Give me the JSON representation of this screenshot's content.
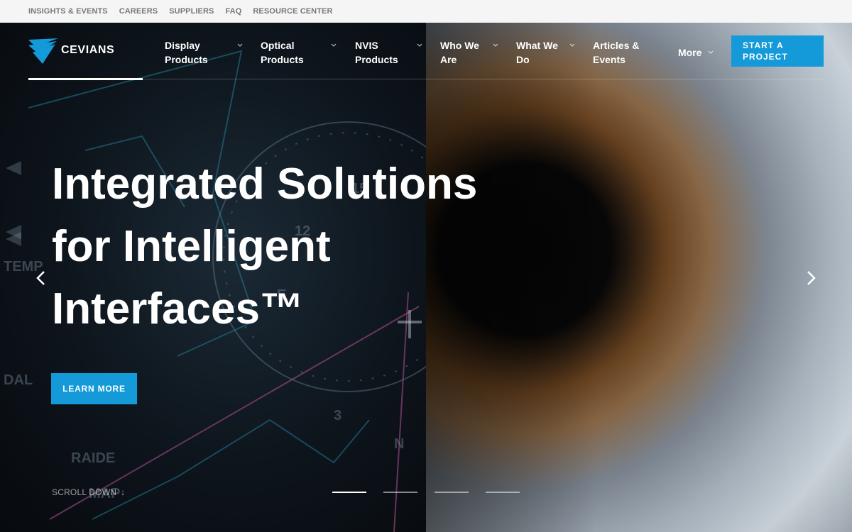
{
  "utility_nav": [
    "INSIGHTS & EVENTS",
    "CAREERS",
    "SUPPLIERS",
    "FAQ",
    "RESOURCE CENTER"
  ],
  "brand": {
    "name": "CEVIANS",
    "accent": "#1499d9"
  },
  "nav": {
    "items": [
      {
        "label": "Display\nProducts",
        "has_dropdown": true
      },
      {
        "label": "Optical\nProducts",
        "has_dropdown": true
      },
      {
        "label": "NVIS\nProducts",
        "has_dropdown": true
      },
      {
        "label": "Who We\nAre",
        "has_dropdown": true
      },
      {
        "label": "What We\nDo",
        "has_dropdown": true
      },
      {
        "label": "Articles &\nEvents",
        "has_dropdown": false
      },
      {
        "label": "More",
        "has_dropdown": true
      }
    ],
    "cta_label": "START A\nPROJECT"
  },
  "hero": {
    "headline_lines": [
      "Integrated Solutions",
      "for Intelligent",
      "Interfaces™"
    ],
    "button_label": "LEARN MORE",
    "scroll_label": "SCROLL DOWN",
    "scroll_icon": "↓",
    "slide_count": 4,
    "active_slide": 1
  }
}
